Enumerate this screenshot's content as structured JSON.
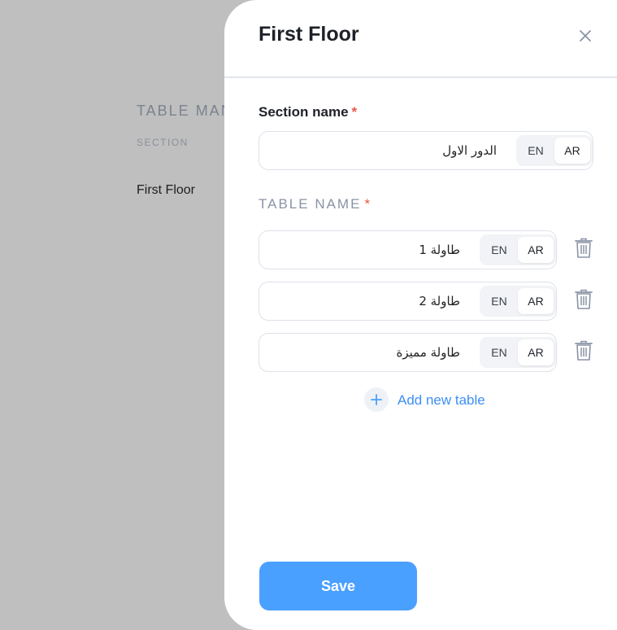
{
  "background": {
    "title": "TABLE MAN",
    "section_label": "SECTION",
    "section_row": "First Floor"
  },
  "drawer": {
    "title": "First Floor",
    "section_name_label": "Section name",
    "required_mark": "*",
    "section_name_value": "الدور الاول",
    "table_name_label": "TABLE NAME",
    "lang_en": "EN",
    "lang_ar": "AR",
    "tables": [
      {
        "value": "طاولة 1"
      },
      {
        "value": "طاولة 2"
      },
      {
        "value": "طاولة مميزة"
      }
    ],
    "add_table_label": "Add new table",
    "save_label": "Save"
  },
  "colors": {
    "accent": "#4aa0ff",
    "link": "#3d8ff5",
    "required": "#e8574d",
    "overlay": "#bfbfbf"
  },
  "icons": [
    "close-icon",
    "trash-icon",
    "plus-icon"
  ]
}
